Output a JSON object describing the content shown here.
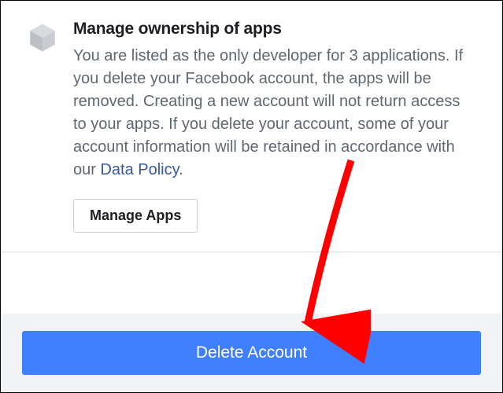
{
  "section": {
    "heading": "Manage ownership of apps",
    "body_before_link": "You are listed as the only developer for 3 applications. If you delete your Facebook account, the apps will be removed. Creating a new account will not return access to your apps. If you delete your account, some of your account information will be retained in accordance with our ",
    "link_text": "Data Policy",
    "body_after_link": ".",
    "manage_button": "Manage Apps"
  },
  "footer": {
    "delete_button": "Delete Account"
  },
  "colors": {
    "primary_button": "#4080ff",
    "link": "#385898",
    "text_body": "#606770",
    "text_heading": "#1c1e21",
    "footer_bg": "#f2f3f5",
    "arrow": "#ff0000"
  }
}
